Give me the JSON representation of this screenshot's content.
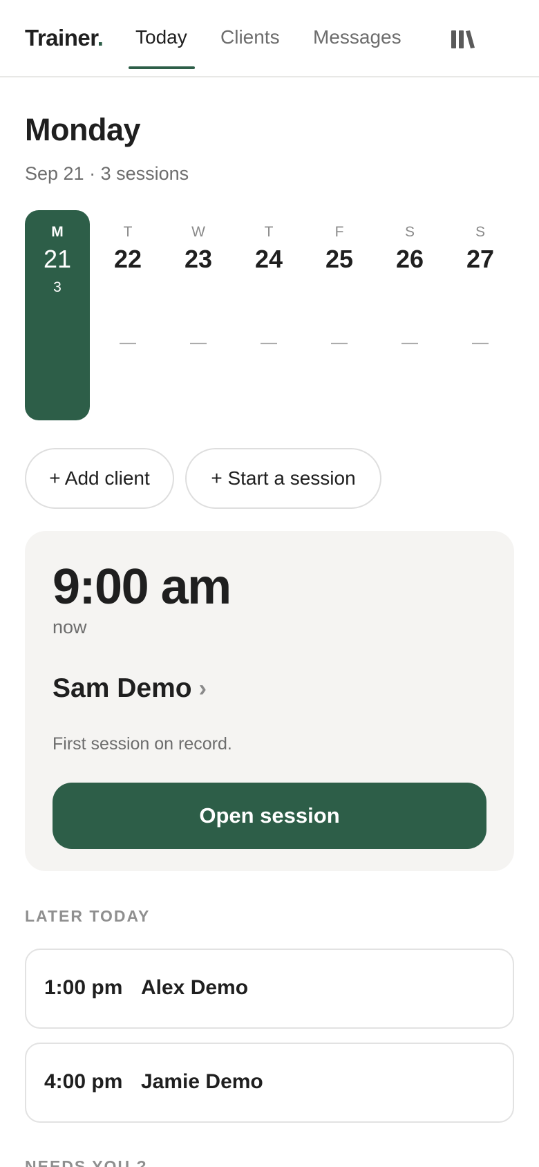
{
  "header": {
    "brand": "Trainer",
    "brand_dot": ".",
    "tabs": [
      {
        "label": "Today"
      },
      {
        "label": "Clients"
      },
      {
        "label": "Messages"
      }
    ],
    "library_icon": "library-icon"
  },
  "day": {
    "title": "Monday",
    "subtitle": "Sep 21 · 3 sessions"
  },
  "week": [
    {
      "dow": "M",
      "date": "21",
      "count": "3",
      "active": true
    },
    {
      "dow": "T",
      "date": "22",
      "empty": "—"
    },
    {
      "dow": "W",
      "date": "23",
      "empty": "—"
    },
    {
      "dow": "T",
      "date": "24",
      "empty": "—"
    },
    {
      "dow": "F",
      "date": "25",
      "empty": "—"
    },
    {
      "dow": "S",
      "date": "26",
      "empty": "—"
    },
    {
      "dow": "S",
      "date": "27",
      "empty": "—"
    }
  ],
  "actions": {
    "add_client": "+ Add client",
    "start_session": "+ Start a session"
  },
  "current": {
    "time": "9:00 am",
    "status": "now",
    "client": "Sam Demo",
    "chevron": "›",
    "note": "First session on record.",
    "open_label": "Open session"
  },
  "later": {
    "label": "LATER TODAY",
    "items": [
      {
        "time": "1:00 pm",
        "client": "Alex Demo"
      },
      {
        "time": "4:00 pm",
        "client": "Jamie Demo"
      }
    ]
  },
  "needs": {
    "label": "NEEDS YOU ?"
  },
  "colors": {
    "accent": "#2d5e48",
    "card_bg": "#f5f4f2",
    "muted_text": "#6d6d6d"
  }
}
